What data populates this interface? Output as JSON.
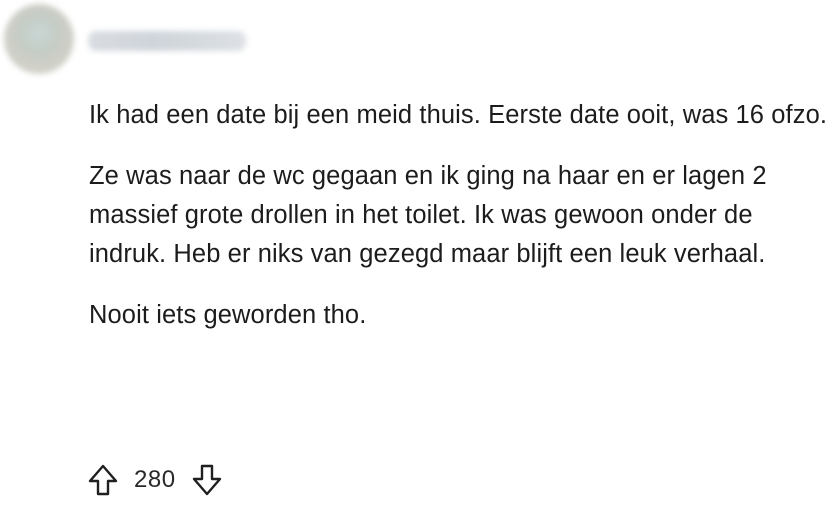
{
  "comment": {
    "author": "",
    "paragraphs": [
      "Ik had een date bij een meid thuis. Eerste date ooit, was 16 ofzo.",
      "Ze was naar de wc gegaan en ik ging na haar en er lagen 2 massief grote drollen in het toilet. Ik was gewoon onder de indruk. Heb er niks van gezegd maar blijft een leuk verhaal.",
      "Nooit iets geworden tho."
    ],
    "score": "280"
  },
  "icons": {
    "upvote": "arrow-up-outline-icon",
    "downvote": "arrow-down-outline-icon"
  }
}
